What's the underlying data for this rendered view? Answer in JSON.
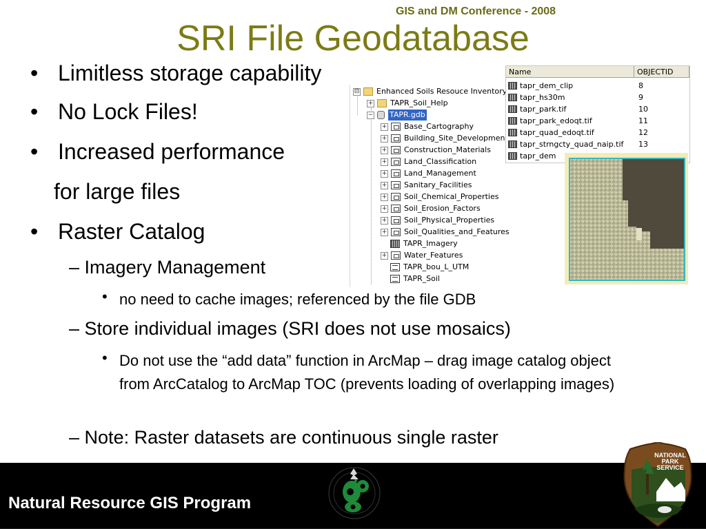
{
  "header": {
    "conference": "GIS and DM Conference - 2008",
    "title": "SRI File Geodatabase"
  },
  "bullets": {
    "b1": "Limitless storage capability",
    "b2": "No Lock Files!",
    "b3": "Increased performance",
    "b3_cont": "for large files",
    "b4": "Raster Catalog",
    "sub1": "Imagery Management",
    "sub1_1": "no need to cache images; referenced by the file GDB",
    "sub2": "Store individual images (SRI does not use mosaics)",
    "sub2_1": "Do not use the “add data” function in ArcMap – drag image catalog object from ArcCatalog to ArcMap TOC (prevents loading of overlapping images)",
    "sub3": "Note:  Raster datasets are continuous single raster",
    "dot": "•",
    "dash": "–"
  },
  "tree": {
    "items": [
      {
        "label": "Enhanced Soils Resouce Inventory",
        "icon": "folder-icon",
        "expander": "⊟"
      },
      {
        "label": "TAPR_Soil_Help",
        "icon": "folder-icon",
        "expander": "+"
      },
      {
        "label": "TAPR.gdb",
        "icon": "geodatabase-icon",
        "expander": "−",
        "selected": true
      },
      {
        "label": "Base_Cartography",
        "icon": "feature-dataset-icon",
        "expander": "+"
      },
      {
        "label": "Building_Site_Development",
        "icon": "feature-dataset-icon",
        "expander": "+"
      },
      {
        "label": "Construction_Materials",
        "icon": "feature-dataset-icon",
        "expander": "+"
      },
      {
        "label": "Land_Classification",
        "icon": "feature-dataset-icon",
        "expander": "+"
      },
      {
        "label": "Land_Management",
        "icon": "feature-dataset-icon",
        "expander": "+"
      },
      {
        "label": "Sanitary_Facilities",
        "icon": "feature-dataset-icon",
        "expander": "+"
      },
      {
        "label": "Soil_Chemical_Properties",
        "icon": "feature-dataset-icon",
        "expander": "+"
      },
      {
        "label": "Soil_Erosion_Factors",
        "icon": "feature-dataset-icon",
        "expander": "+"
      },
      {
        "label": "Soil_Physical_Properties",
        "icon": "feature-dataset-icon",
        "expander": "+"
      },
      {
        "label": "Soil_Qualities_and_Features",
        "icon": "feature-dataset-icon",
        "expander": "+"
      },
      {
        "label": "TAPR_Imagery",
        "icon": "raster-catalog-icon",
        "expander": ""
      },
      {
        "label": "Water_Features",
        "icon": "feature-dataset-icon",
        "expander": "+"
      },
      {
        "label": "TAPR_bou_L_UTM",
        "icon": "feature-class-icon",
        "expander": ""
      },
      {
        "label": "TAPR_Soil",
        "icon": "feature-class-icon",
        "expander": ""
      }
    ]
  },
  "catalog": {
    "columns": [
      "Name",
      "OBJECTID"
    ],
    "rows": [
      {
        "name": "tapr_dem_clip",
        "id": "8"
      },
      {
        "name": "tapr_hs30m",
        "id": "9"
      },
      {
        "name": "tapr_park.tif",
        "id": "10"
      },
      {
        "name": "tapr_park_edoqt.tif",
        "id": "11"
      },
      {
        "name": "tapr_quad_edoqt.tif",
        "id": "12"
      },
      {
        "name": "tapr_strngcty_quad_naip.tif",
        "id": "13"
      },
      {
        "name": "tapr_dem",
        "id": ""
      }
    ]
  },
  "footer": {
    "program": "Natural Resource GIS Program",
    "nps_logo_text": [
      "NATIONAL",
      "PARK",
      "SERVICE"
    ]
  },
  "colors": {
    "title": "#7c7b15",
    "conference": "#6b6a16",
    "footer_bg": "#000000",
    "selection": "#3165c5",
    "preview_bg": "#f2ecb8",
    "map_frame": "#34b6c0"
  }
}
